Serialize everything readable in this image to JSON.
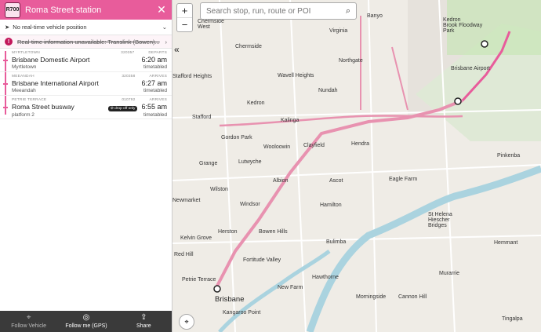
{
  "header": {
    "route": "R700",
    "title": "Roma Street station",
    "close": "✕"
  },
  "vehicle": {
    "label": "No real-time vehicle position",
    "chevron": "⌄"
  },
  "alert": {
    "text": "Real-time information unavailable: Translink (Bowen)...",
    "chevron": "›"
  },
  "stops": [
    {
      "area": "MYRTLETOWN",
      "code": "320357",
      "status": "DEPARTS",
      "name": "Brisbane Domestic Airport",
      "sub": "Myrtletown",
      "time": "6:20 am",
      "timetabled": "timetabled",
      "badge": ""
    },
    {
      "area": "MEEANDAH",
      "code": "320358",
      "status": "ARRIVES",
      "name": "Brisbane International Airport",
      "sub": "Meeandah",
      "time": "6:27 am",
      "timetabled": "timetabled",
      "badge": ""
    },
    {
      "area": "PETRIE TERRACE",
      "code": "010792",
      "status": "ARRIVES",
      "name": "Roma Street busway",
      "sub": "platform 2",
      "time": "6:55 am",
      "timetabled": "timetabled",
      "badge": "drop off only"
    }
  ],
  "footer": {
    "follow_vehicle": "Follow Vehicle",
    "follow_me": "Follow me (GPS)",
    "share": "Share"
  },
  "map": {
    "search_placeholder": "Search stop, run, route or POI",
    "zoom_in": "+",
    "zoom_out": "−",
    "labels": {
      "banyo": "Banyo",
      "kedron": "Kedron\nBrook Floodway\nPark",
      "chermside_west": "Chermside\nWest",
      "virginia": "Virginia",
      "chermside": "Chermside",
      "northgate": "Northgate",
      "brisbane_airport": "Brisbane Airport",
      "wavell": "Wavell Heights",
      "stafford_heights": "Stafford Heights",
      "nundah": "Nundah",
      "kedron_s": "Kedron",
      "stafford": "Stafford",
      "kalinga": "Kalinga",
      "gordon_park": "Gordon Park",
      "wooloowin": "Wooloowin",
      "clayfield": "Clayfield",
      "hendra": "Hendra",
      "grange": "Grange",
      "lutwyche": "Lutwyche",
      "pinkenba": "Pinkenba",
      "wilston": "Wilston",
      "albion": "Albion",
      "ascot": "Ascot",
      "eagle_farm": "Eagle Farm",
      "newmarket": "Newmarket",
      "windsor": "Windsor",
      "hamilton": "Hamilton",
      "kelvin_grove": "Kelvin Grove",
      "herston": "Herston",
      "bowen_hills": "Bowen Hills",
      "bulimba": "Bulimba",
      "fortitude": "Fortitude Valley",
      "hawthorne": "Hawthorne",
      "petrie": "Petrie Terrace",
      "new_farm": "New Farm",
      "brisbane": "Brisbane",
      "kangaroo": "Kangaroo Point",
      "morningside": "Morningside",
      "cannon_hill": "Cannon Hill",
      "murarrie": "Murarrie",
      "hemmant": "Hemmant",
      "tingalpa": "Tingalpa",
      "red_hill": "Red Hill",
      "st_lucia": "St Helena\nHiescher\nBridges"
    }
  },
  "colors": {
    "accent": "#e85c9b",
    "road_major": "#e892b0",
    "river": "#aad3df",
    "park": "#c8e6b6"
  }
}
